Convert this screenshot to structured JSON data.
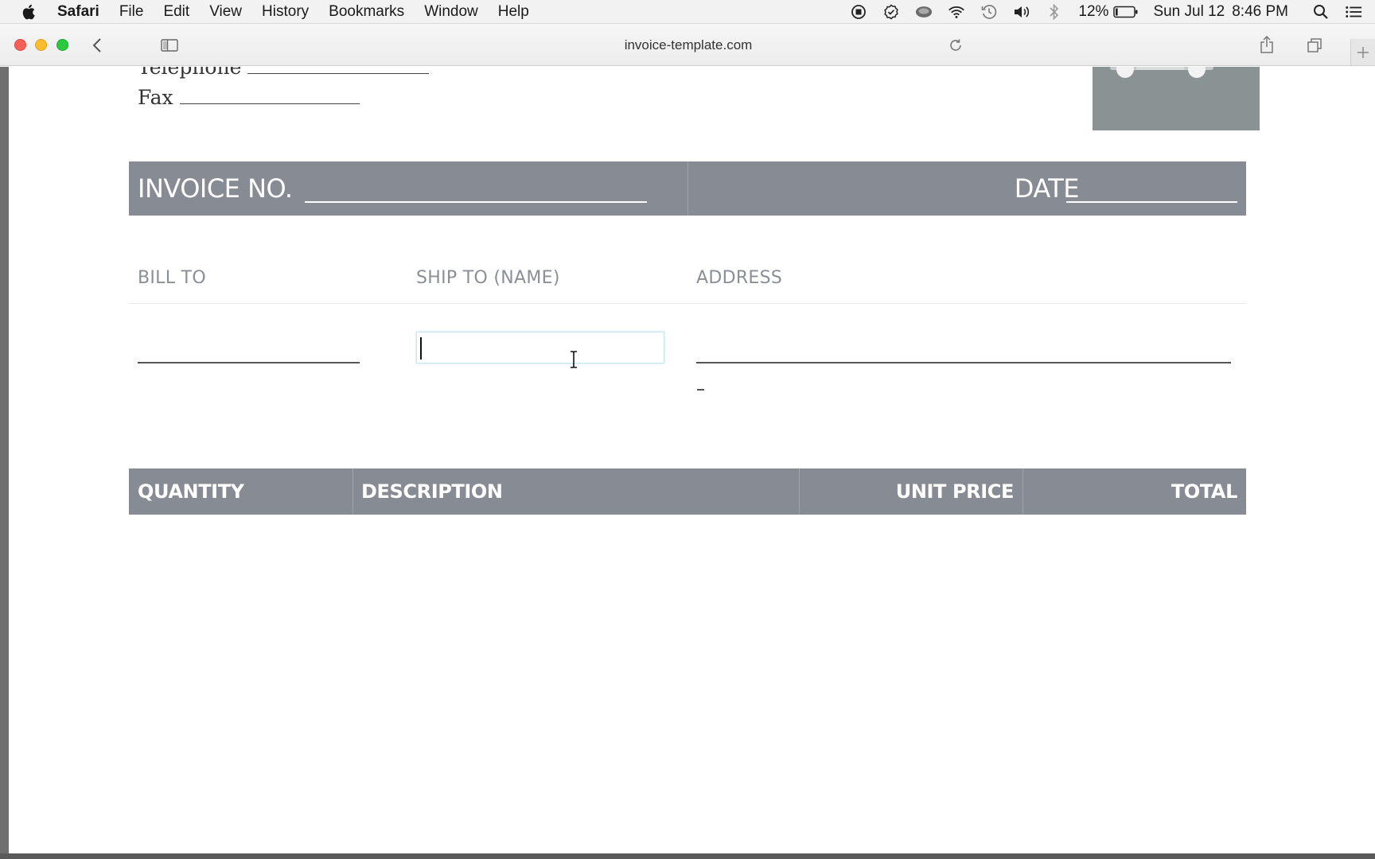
{
  "menubar": {
    "app_name": "Safari",
    "items": [
      "File",
      "Edit",
      "View",
      "History",
      "Bookmarks",
      "Window",
      "Help"
    ],
    "status": {
      "icons": [
        "stop-record-icon",
        "checkmark-badge-icon",
        "cloud-app-icon",
        "wifi-icon",
        "time-machine-icon",
        "volume-icon",
        "bluetooth-icon"
      ],
      "battery_percent": "12%",
      "battery_level": 0.12,
      "date": "Sun Jul 12",
      "time": "8:46 PM"
    }
  },
  "toolbar": {
    "url": "invoice-template.com"
  },
  "invoice": {
    "telephone_label": "Telephone",
    "fax_label": "Fax",
    "invoice_no_label": "INVOICE NO.",
    "date_label": "DATE",
    "bill_to_label": "BILL TO",
    "ship_to_label": "SHIP TO (NAME)",
    "address_label": "ADDRESS",
    "ship_to_value": "",
    "items_columns": {
      "quantity": "QUANTITY",
      "description": "DESCRIPTION",
      "unit_price": "UNIT PRICE",
      "total": "TOTAL"
    }
  },
  "colors": {
    "band": "#878b93",
    "header_text": "#8a8f97",
    "logo_placeholder": "#8a9393",
    "focus_ring": "#bfe4f3"
  }
}
